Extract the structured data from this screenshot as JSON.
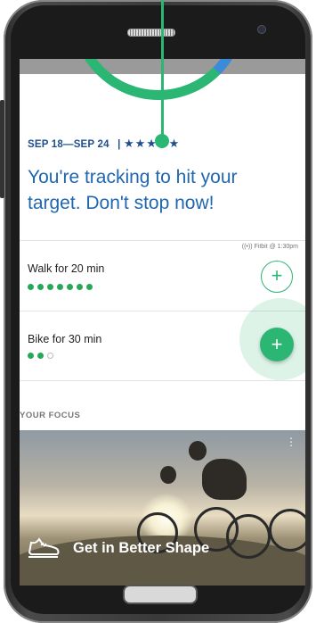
{
  "goal": {
    "week_range": "SEP 18—SEP 24",
    "separator": "|",
    "stars": "★★★★★",
    "headline": "You're tracking to hit your target. Don't stop now!"
  },
  "activities": [
    {
      "title": "Walk for 20 min",
      "progress": 7,
      "total": 7,
      "sync": "((•)) Fitbit @ 1:30pm",
      "add": "+"
    },
    {
      "title": "Bike for 30 min",
      "progress": 2,
      "total": 3,
      "add": "+"
    }
  ],
  "focus": {
    "section_label": "YOUR FOCUS",
    "card_title": "Get in Better Shape",
    "menu": "⋮"
  },
  "colors": {
    "accent_green": "#2bb673",
    "blue_text": "#1f67b0",
    "navy_text": "#1f4f8e"
  }
}
